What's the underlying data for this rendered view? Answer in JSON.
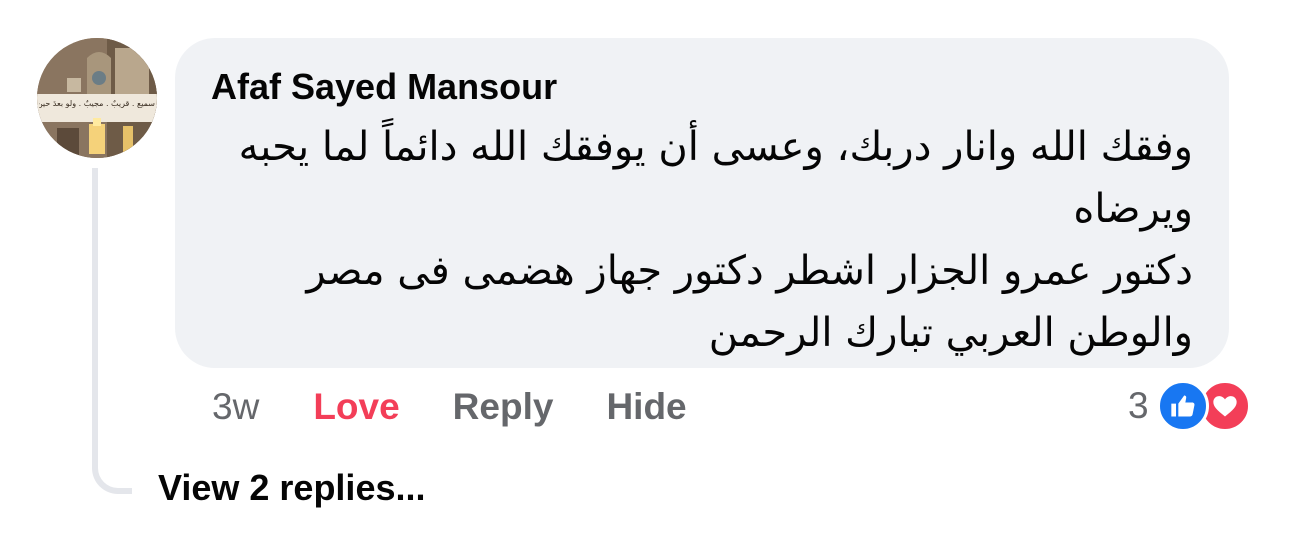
{
  "comment": {
    "author": "Afaf Sayed Mansour",
    "lines": [
      "وفقك الله وانار  دربك، وعسى أن يوفقك الله دائماً لما يحبه",
      "ويرضاه",
      "دكتور عمرو الجزار اشطر دكتور جهاز هضمى فى مصر",
      "والوطن العربي تبارك الرحمن"
    ],
    "avatar_caption": "سميع . قريبٌ . مجيبٌ . ولو بعدَ حين"
  },
  "actions": {
    "time": "3w",
    "love_label": "Love",
    "reply_label": "Reply",
    "hide_label": "Hide"
  },
  "reactions": {
    "count": "3",
    "icons": [
      "like-icon",
      "love-icon"
    ],
    "like_color": "#1877f2",
    "love_color": "#f33e58"
  },
  "replies": {
    "label": "View 2 replies..."
  },
  "colors": {
    "bubble": "#f0f2f5",
    "secondary_text": "#65676b",
    "love_accent": "#f33e58"
  }
}
